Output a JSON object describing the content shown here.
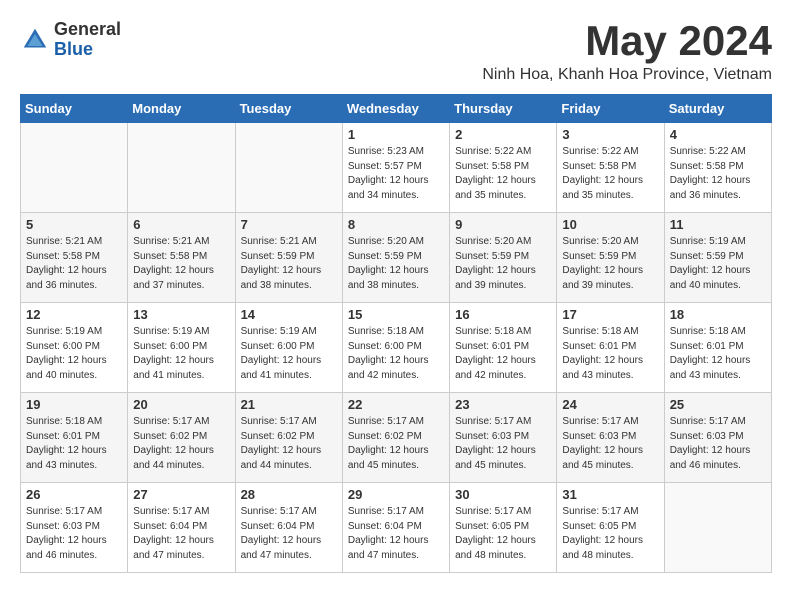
{
  "logo": {
    "general": "General",
    "blue": "Blue"
  },
  "title": "May 2024",
  "location": "Ninh Hoa, Khanh Hoa Province, Vietnam",
  "days_of_week": [
    "Sunday",
    "Monday",
    "Tuesday",
    "Wednesday",
    "Thursday",
    "Friday",
    "Saturday"
  ],
  "weeks": [
    [
      {
        "day": "",
        "sunrise": "",
        "sunset": "",
        "daylight": ""
      },
      {
        "day": "",
        "sunrise": "",
        "sunset": "",
        "daylight": ""
      },
      {
        "day": "",
        "sunrise": "",
        "sunset": "",
        "daylight": ""
      },
      {
        "day": "1",
        "sunrise": "Sunrise: 5:23 AM",
        "sunset": "Sunset: 5:57 PM",
        "daylight": "Daylight: 12 hours and 34 minutes."
      },
      {
        "day": "2",
        "sunrise": "Sunrise: 5:22 AM",
        "sunset": "Sunset: 5:58 PM",
        "daylight": "Daylight: 12 hours and 35 minutes."
      },
      {
        "day": "3",
        "sunrise": "Sunrise: 5:22 AM",
        "sunset": "Sunset: 5:58 PM",
        "daylight": "Daylight: 12 hours and 35 minutes."
      },
      {
        "day": "4",
        "sunrise": "Sunrise: 5:22 AM",
        "sunset": "Sunset: 5:58 PM",
        "daylight": "Daylight: 12 hours and 36 minutes."
      }
    ],
    [
      {
        "day": "5",
        "sunrise": "Sunrise: 5:21 AM",
        "sunset": "Sunset: 5:58 PM",
        "daylight": "Daylight: 12 hours and 36 minutes."
      },
      {
        "day": "6",
        "sunrise": "Sunrise: 5:21 AM",
        "sunset": "Sunset: 5:58 PM",
        "daylight": "Daylight: 12 hours and 37 minutes."
      },
      {
        "day": "7",
        "sunrise": "Sunrise: 5:21 AM",
        "sunset": "Sunset: 5:59 PM",
        "daylight": "Daylight: 12 hours and 38 minutes."
      },
      {
        "day": "8",
        "sunrise": "Sunrise: 5:20 AM",
        "sunset": "Sunset: 5:59 PM",
        "daylight": "Daylight: 12 hours and 38 minutes."
      },
      {
        "day": "9",
        "sunrise": "Sunrise: 5:20 AM",
        "sunset": "Sunset: 5:59 PM",
        "daylight": "Daylight: 12 hours and 39 minutes."
      },
      {
        "day": "10",
        "sunrise": "Sunrise: 5:20 AM",
        "sunset": "Sunset: 5:59 PM",
        "daylight": "Daylight: 12 hours and 39 minutes."
      },
      {
        "day": "11",
        "sunrise": "Sunrise: 5:19 AM",
        "sunset": "Sunset: 5:59 PM",
        "daylight": "Daylight: 12 hours and 40 minutes."
      }
    ],
    [
      {
        "day": "12",
        "sunrise": "Sunrise: 5:19 AM",
        "sunset": "Sunset: 6:00 PM",
        "daylight": "Daylight: 12 hours and 40 minutes."
      },
      {
        "day": "13",
        "sunrise": "Sunrise: 5:19 AM",
        "sunset": "Sunset: 6:00 PM",
        "daylight": "Daylight: 12 hours and 41 minutes."
      },
      {
        "day": "14",
        "sunrise": "Sunrise: 5:19 AM",
        "sunset": "Sunset: 6:00 PM",
        "daylight": "Daylight: 12 hours and 41 minutes."
      },
      {
        "day": "15",
        "sunrise": "Sunrise: 5:18 AM",
        "sunset": "Sunset: 6:00 PM",
        "daylight": "Daylight: 12 hours and 42 minutes."
      },
      {
        "day": "16",
        "sunrise": "Sunrise: 5:18 AM",
        "sunset": "Sunset: 6:01 PM",
        "daylight": "Daylight: 12 hours and 42 minutes."
      },
      {
        "day": "17",
        "sunrise": "Sunrise: 5:18 AM",
        "sunset": "Sunset: 6:01 PM",
        "daylight": "Daylight: 12 hours and 43 minutes."
      },
      {
        "day": "18",
        "sunrise": "Sunrise: 5:18 AM",
        "sunset": "Sunset: 6:01 PM",
        "daylight": "Daylight: 12 hours and 43 minutes."
      }
    ],
    [
      {
        "day": "19",
        "sunrise": "Sunrise: 5:18 AM",
        "sunset": "Sunset: 6:01 PM",
        "daylight": "Daylight: 12 hours and 43 minutes."
      },
      {
        "day": "20",
        "sunrise": "Sunrise: 5:17 AM",
        "sunset": "Sunset: 6:02 PM",
        "daylight": "Daylight: 12 hours and 44 minutes."
      },
      {
        "day": "21",
        "sunrise": "Sunrise: 5:17 AM",
        "sunset": "Sunset: 6:02 PM",
        "daylight": "Daylight: 12 hours and 44 minutes."
      },
      {
        "day": "22",
        "sunrise": "Sunrise: 5:17 AM",
        "sunset": "Sunset: 6:02 PM",
        "daylight": "Daylight: 12 hours and 45 minutes."
      },
      {
        "day": "23",
        "sunrise": "Sunrise: 5:17 AM",
        "sunset": "Sunset: 6:03 PM",
        "daylight": "Daylight: 12 hours and 45 minutes."
      },
      {
        "day": "24",
        "sunrise": "Sunrise: 5:17 AM",
        "sunset": "Sunset: 6:03 PM",
        "daylight": "Daylight: 12 hours and 45 minutes."
      },
      {
        "day": "25",
        "sunrise": "Sunrise: 5:17 AM",
        "sunset": "Sunset: 6:03 PM",
        "daylight": "Daylight: 12 hours and 46 minutes."
      }
    ],
    [
      {
        "day": "26",
        "sunrise": "Sunrise: 5:17 AM",
        "sunset": "Sunset: 6:03 PM",
        "daylight": "Daylight: 12 hours and 46 minutes."
      },
      {
        "day": "27",
        "sunrise": "Sunrise: 5:17 AM",
        "sunset": "Sunset: 6:04 PM",
        "daylight": "Daylight: 12 hours and 47 minutes."
      },
      {
        "day": "28",
        "sunrise": "Sunrise: 5:17 AM",
        "sunset": "Sunset: 6:04 PM",
        "daylight": "Daylight: 12 hours and 47 minutes."
      },
      {
        "day": "29",
        "sunrise": "Sunrise: 5:17 AM",
        "sunset": "Sunset: 6:04 PM",
        "daylight": "Daylight: 12 hours and 47 minutes."
      },
      {
        "day": "30",
        "sunrise": "Sunrise: 5:17 AM",
        "sunset": "Sunset: 6:05 PM",
        "daylight": "Daylight: 12 hours and 48 minutes."
      },
      {
        "day": "31",
        "sunrise": "Sunrise: 5:17 AM",
        "sunset": "Sunset: 6:05 PM",
        "daylight": "Daylight: 12 hours and 48 minutes."
      },
      {
        "day": "",
        "sunrise": "",
        "sunset": "",
        "daylight": ""
      }
    ]
  ]
}
